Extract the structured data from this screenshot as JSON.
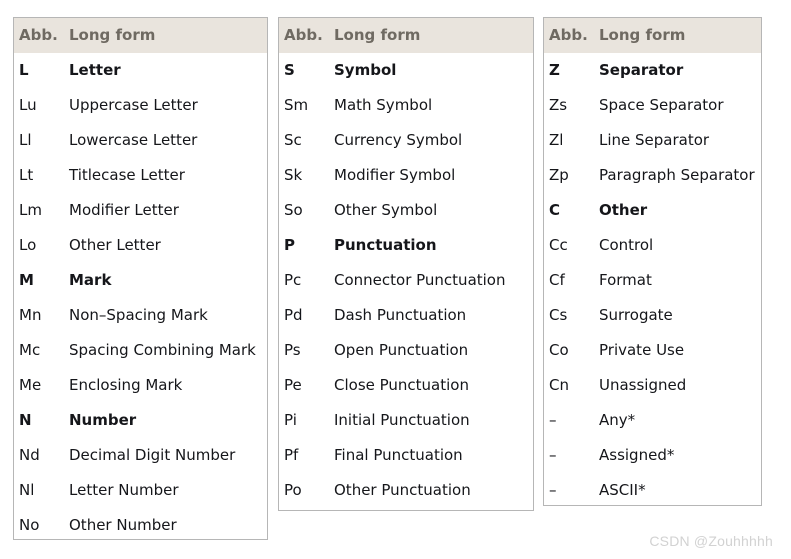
{
  "page": {
    "background_color": "#ffffff",
    "watermark": "CSDN @Zouhhhhh"
  },
  "style": {
    "header_background": "#e9e4dd",
    "header_text_color": "#6f6a62",
    "body_text_color": "#15161a",
    "border_color": "#b6b6b6"
  },
  "columns": {
    "abbreviation": "Abb.",
    "long_form": "Long form"
  },
  "tables": [
    {
      "id": "table-letters-marks-numbers",
      "header": {
        "abb": "Abb.",
        "long": "Long form"
      },
      "rows": [
        {
          "abb": "L",
          "long": "Letter",
          "major": true
        },
        {
          "abb": "Lu",
          "long": "Uppercase Letter",
          "major": false
        },
        {
          "abb": "Ll",
          "long": "Lowercase Letter",
          "major": false
        },
        {
          "abb": "Lt",
          "long": "Titlecase Letter",
          "major": false
        },
        {
          "abb": "Lm",
          "long": "Modifier Letter",
          "major": false
        },
        {
          "abb": "Lo",
          "long": "Other Letter",
          "major": false
        },
        {
          "abb": "M",
          "long": "Mark",
          "major": true
        },
        {
          "abb": "Mn",
          "long": "Non–Spacing Mark",
          "major": false
        },
        {
          "abb": "Mc",
          "long": "Spacing Combining Mark",
          "major": false
        },
        {
          "abb": "Me",
          "long": "Enclosing Mark",
          "major": false
        },
        {
          "abb": "N",
          "long": "Number",
          "major": true
        },
        {
          "abb": "Nd",
          "long": "Decimal Digit Number",
          "major": false
        },
        {
          "abb": "Nl",
          "long": "Letter Number",
          "major": false
        },
        {
          "abb": "No",
          "long": "Other Number",
          "major": false
        }
      ]
    },
    {
      "id": "table-symbols-punctuation",
      "header": {
        "abb": "Abb.",
        "long": "Long form"
      },
      "rows": [
        {
          "abb": "S",
          "long": "Symbol",
          "major": true
        },
        {
          "abb": "Sm",
          "long": "Math Symbol",
          "major": false
        },
        {
          "abb": "Sc",
          "long": "Currency Symbol",
          "major": false
        },
        {
          "abb": "Sk",
          "long": "Modifier Symbol",
          "major": false
        },
        {
          "abb": "So",
          "long": "Other Symbol",
          "major": false
        },
        {
          "abb": "P",
          "long": "Punctuation",
          "major": true
        },
        {
          "abb": "Pc",
          "long": "Connector Punctuation",
          "major": false
        },
        {
          "abb": "Pd",
          "long": "Dash Punctuation",
          "major": false
        },
        {
          "abb": "Ps",
          "long": "Open Punctuation",
          "major": false
        },
        {
          "abb": "Pe",
          "long": "Close Punctuation",
          "major": false
        },
        {
          "abb": "Pi",
          "long": "Initial Punctuation",
          "major": false
        },
        {
          "abb": "Pf",
          "long": "Final Punctuation",
          "major": false
        },
        {
          "abb": "Po",
          "long": "Other Punctuation",
          "major": false
        }
      ]
    },
    {
      "id": "table-separators-other",
      "header": {
        "abb": "Abb.",
        "long": "Long form"
      },
      "rows": [
        {
          "abb": "Z",
          "long": "Separator",
          "major": true
        },
        {
          "abb": "Zs",
          "long": "Space Separator",
          "major": false
        },
        {
          "abb": "Zl",
          "long": "Line Separator",
          "major": false
        },
        {
          "abb": "Zp",
          "long": "Paragraph Separator",
          "major": false
        },
        {
          "abb": "C",
          "long": "Other",
          "major": true
        },
        {
          "abb": "Cc",
          "long": "Control",
          "major": false
        },
        {
          "abb": "Cf",
          "long": "Format",
          "major": false
        },
        {
          "abb": "Cs",
          "long": "Surrogate",
          "major": false
        },
        {
          "abb": "Co",
          "long": "Private Use",
          "major": false
        },
        {
          "abb": "Cn",
          "long": "Unassigned",
          "major": false
        },
        {
          "abb": "–",
          "long": "Any*",
          "major": false
        },
        {
          "abb": "–",
          "long": "Assigned*",
          "major": false
        },
        {
          "abb": "–",
          "long": "ASCII*",
          "major": false
        }
      ]
    }
  ]
}
